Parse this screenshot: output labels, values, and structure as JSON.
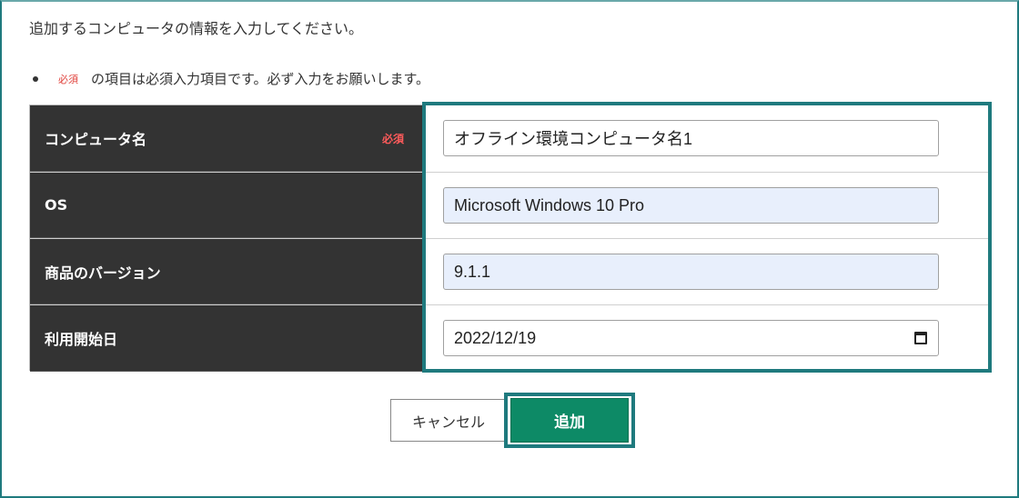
{
  "intro_text": "追加するコンピュータの情報を入力してください。",
  "note": {
    "required_tag": "必須",
    "text": "の項目は必須入力項目です。必ず入力をお願いします。"
  },
  "form": {
    "rows": [
      {
        "label": "コンピュータ名",
        "required_tag": "必須",
        "value": "オフライン環境コンピュータ名1"
      },
      {
        "label": "OS",
        "value": "Microsoft Windows 10 Pro"
      },
      {
        "label": "商品のバージョン",
        "value": "9.1.1"
      },
      {
        "label": "利用開始日",
        "value": "2022/12/19",
        "icon": "calendar-icon"
      }
    ]
  },
  "buttons": {
    "cancel_label": "キャンセル",
    "add_label": "追加"
  },
  "colors": {
    "highlight": "#1f7a7e",
    "primary_button": "#0d8a66",
    "label_bg": "#333333",
    "required": "#ff5b5b",
    "autofill_bg": "#e8effc"
  }
}
